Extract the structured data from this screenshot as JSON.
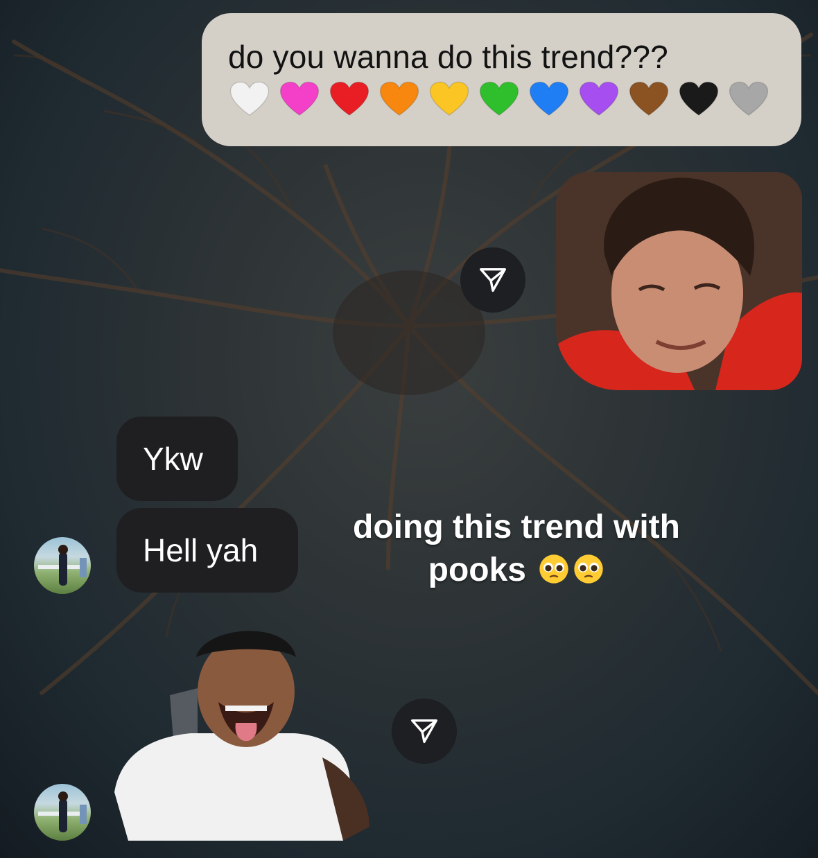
{
  "chat": {
    "outgoing_message": {
      "text": "do you wanna do this trend???",
      "hearts": [
        {
          "name": "white-heart-icon",
          "color": "#f2f2f2"
        },
        {
          "name": "pink-heart-icon",
          "color": "#f43fc8"
        },
        {
          "name": "red-heart-icon",
          "color": "#e81e24"
        },
        {
          "name": "orange-heart-icon",
          "color": "#f7870e"
        },
        {
          "name": "yellow-heart-icon",
          "color": "#fbc524"
        },
        {
          "name": "green-heart-icon",
          "color": "#2fbf2d"
        },
        {
          "name": "blue-heart-icon",
          "color": "#1f7ef3"
        },
        {
          "name": "purple-heart-icon",
          "color": "#a64ef0"
        },
        {
          "name": "brown-heart-icon",
          "color": "#8b5222"
        },
        {
          "name": "black-heart-icon",
          "color": "#1a1a1a"
        },
        {
          "name": "grey-heart-icon",
          "color": "#a7a7a7"
        }
      ]
    },
    "incoming_messages": [
      "Ykw",
      "Hell yah"
    ],
    "overlay_caption": "doing this trend with pooks",
    "caption_emoji": [
      "pleading-face-icon",
      "pleading-face-icon"
    ],
    "icons": {
      "share": "paper-plane-icon",
      "avatar": "avatar"
    }
  }
}
